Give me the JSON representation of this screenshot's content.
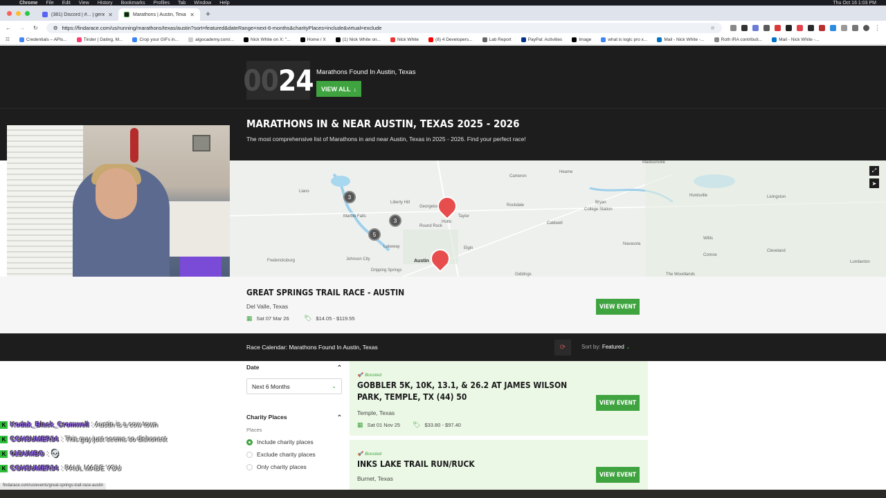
{
  "menubar": {
    "items": [
      "Chrome",
      "File",
      "Edit",
      "View",
      "History",
      "Bookmarks",
      "Profiles",
      "Tab",
      "Window",
      "Help"
    ],
    "clock": "Thu Oct 16  1:03 PM"
  },
  "tabs": [
    {
      "title": "(381) Discord | #... | generic"
    },
    {
      "title": "Marathons | Austin, Texas | 20..."
    }
  ],
  "address": {
    "url": "https://findarace.com/us/running/marathons/texas/austin?sort=featured&dateRange=next-6-months&charityPlaces=include&virtual=exclude"
  },
  "bookmarks": [
    "Credentials – APIs...",
    "Tinder | Dating, M...",
    "Crop your GIFs in...",
    "algocademy.com/...",
    "Nick White on X: \"...",
    "Home / X",
    "(1) Nick White on...",
    "Nick White",
    "(8) 4 Developers...",
    "Lab Report",
    "PayPal: Activities",
    "Image",
    "what is logic pro x...",
    "Mail - Nick White -...",
    "Roth IRA contributi...",
    "Mail - Nick White -..."
  ],
  "hero": {
    "counter_dim": "00",
    "counter_lit": "24",
    "found_text": "Marathons Found In Austin, Texas",
    "view_all": "VIEW ALL",
    "title": "MARATHONS IN & NEAR AUSTIN, TEXAS 2025 - 2026",
    "subtitle": "The most comprehensive list of Marathons in and near Austin, Texas in 2025 - 2026. Find your perfect race!"
  },
  "map": {
    "labels": [
      "Heame",
      "Madisonville",
      "Cameron",
      "Rockdale",
      "Bryan",
      "College Station",
      "Huntsville",
      "Livingston",
      "Llano",
      "Liberty Hill",
      "Georgetown",
      "Taylor",
      "Marble Falls",
      "Round Rock",
      "Hutto",
      "Caldwell",
      "Navasota",
      "Willis",
      "Cleveland",
      "Conroe",
      "Elgin",
      "Johnson City",
      "Austin",
      "Fredericksburg",
      "Lakeway",
      "Dripping Springs",
      "Giddings",
      "Lumberton",
      "The Woodlands"
    ],
    "clusters": [
      "3",
      "3",
      "5"
    ]
  },
  "featured": {
    "title": "GREAT SPRINGS TRAIL RACE - AUSTIN",
    "location": "Del Valle, Texas",
    "date": "Sat 07 Mar 26",
    "price": "$14.05 - $119.55",
    "button": "VIEW EVENT"
  },
  "calendar": {
    "title": "Race Calendar: Marathons Found In Austin, Texas",
    "sort_label": "Sort by:",
    "sort_value": "Featured"
  },
  "filters": {
    "date_heading": "Date",
    "date_value": "Next 6 Months",
    "charity_heading": "Charity Places",
    "places_label": "Places",
    "options": [
      "Include charity places",
      "Exclude charity places",
      "Only charity places"
    ]
  },
  "events": [
    {
      "boost": "Boosted",
      "title": "GOBBLER 5K, 10K, 13.1, & 26.2 AT JAMES WILSON PARK, TEMPLE, TX (44) 50",
      "location": "Temple, Texas",
      "date": "Sat 01 Nov 25",
      "price": "$33.80 - $97.40",
      "button": "VIEW EVENT"
    },
    {
      "boost": "Boosted",
      "title": "INKS LAKE TRAIL RUN/RUCK",
      "location": "Burnet, Texas",
      "button": "VIEW EVENT"
    }
  ],
  "chat": [
    {
      "user": "Kodak_Black_Cromwell",
      "msg": ": Austin is a cow town"
    },
    {
      "user": "CONSUMER34",
      "msg": ": This guy just seems so dishonest"
    },
    {
      "user": "01DUMBO",
      "msg": ": 💀"
    },
    {
      "user": "CONSUMER34",
      "msg": ": PAUL MADE YOU"
    }
  ],
  "status_url": "findarace.com/us/events/great-springs-trail-race-austin",
  "colors": {
    "accent": "#3fa33f",
    "dark": "#1d1d1d",
    "boosted_bg": "#ecf8e6",
    "pin": "#e84d4d",
    "chat_user": "#9d6bff"
  }
}
